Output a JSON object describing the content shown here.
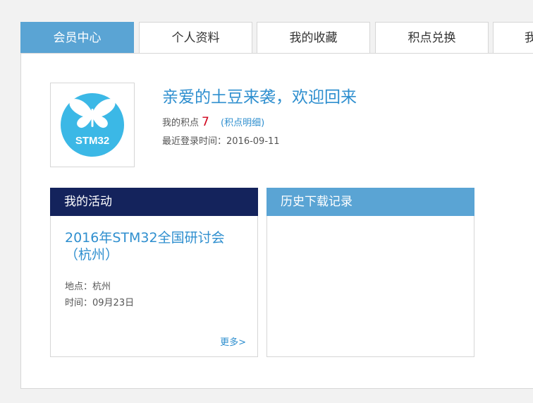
{
  "tabs": [
    {
      "label": "会员中心",
      "active": true
    },
    {
      "label": "个人资料",
      "active": false
    },
    {
      "label": "我的收藏",
      "active": false
    },
    {
      "label": "积点兑换",
      "active": false
    },
    {
      "label": "我",
      "active": false
    }
  ],
  "profile": {
    "logo_text": "STM32",
    "welcome": "亲爱的土豆来袭，欢迎回来",
    "points_label": "我的积点",
    "points_value": "7",
    "points_detail_open": "(",
    "points_detail_label": "积点明细",
    "points_detail_close": ")",
    "last_login": "最近登录时间：2016-09-11"
  },
  "activity": {
    "header": "我的活动",
    "event_title": "2016年STM32全国研讨会（杭州）",
    "location": "地点：杭州",
    "time": "时间：09月23日",
    "more": "更多>"
  },
  "history": {
    "header": "历史下载记录"
  },
  "colors": {
    "accent": "#5aa4d4",
    "link": "#2f8fcf",
    "dark_header": "#14235c",
    "points_red": "#d0021b",
    "logo_blue": "#3bb8e6"
  }
}
